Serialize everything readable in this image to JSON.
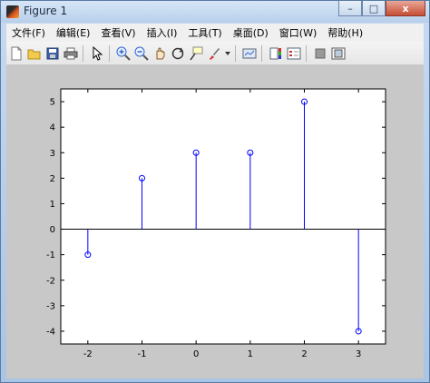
{
  "window": {
    "title": "Figure 1"
  },
  "window_buttons": {
    "minimize": "–",
    "maximize": "□",
    "close": "x"
  },
  "menu": [
    "文件(F)",
    "编辑(E)",
    "查看(V)",
    "插入(I)",
    "工具(T)",
    "桌面(D)",
    "窗口(W)",
    "帮助(H)"
  ],
  "toolbar_icons": [
    "new-figure-icon",
    "open-file-icon",
    "save-icon",
    "print-icon",
    "pointer-icon",
    "zoom-in-icon",
    "zoom-out-icon",
    "pan-icon",
    "rotate-3d-icon",
    "data-cursor-icon",
    "brush-icon",
    "link-plot-icon",
    "colorbar-icon",
    "legend-icon",
    "hide-plot-tools-icon",
    "show-plot-tools-icon"
  ],
  "chart_data": {
    "type": "stem",
    "x": [
      -2,
      -1,
      0,
      1,
      2,
      3
    ],
    "y": [
      -1,
      2,
      3,
      3,
      5,
      -4
    ],
    "xlim": [
      -2.5,
      3.5
    ],
    "ylim": [
      -4.5,
      5.5
    ],
    "xticks": [
      "-2",
      "-1",
      "0",
      "1",
      "2",
      "3"
    ],
    "yticks": [
      "-4",
      "-3",
      "-2",
      "-1",
      "0",
      "1",
      "2",
      "3",
      "4",
      "5"
    ],
    "stem_color": "#0000ff",
    "baseline_color": "#000000",
    "marker": "circle"
  }
}
